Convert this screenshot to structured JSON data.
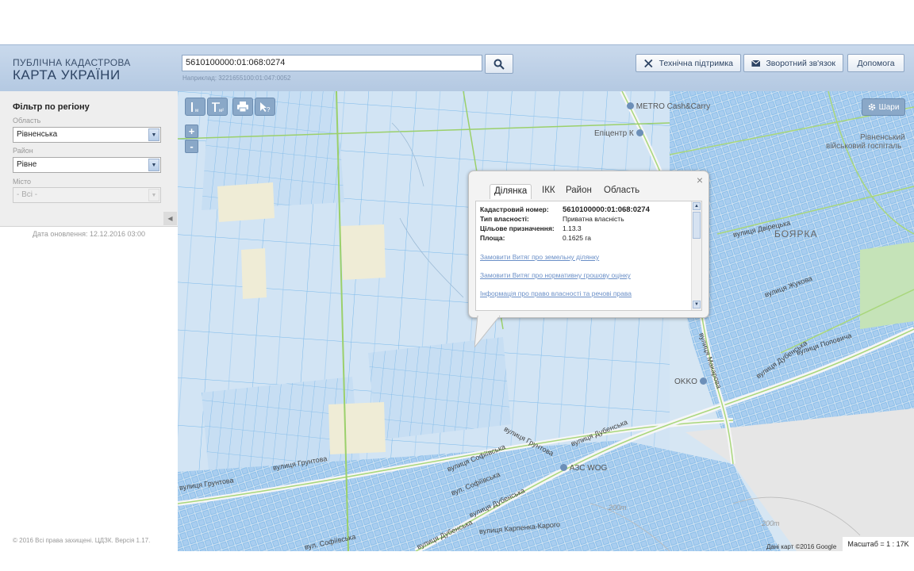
{
  "header": {
    "logo_line1": "ПУБЛІЧНА КАДАСТРОВА",
    "logo_line2": "КАРТА УКРАЇНИ",
    "search_value": "5610100000:01:068:0274",
    "search_example": "Наприклад: 3221655100:01:047:0052",
    "support_label": "Технічна підтримка",
    "feedback_label": "Зворотний зв'язок",
    "help_label": "Допомога"
  },
  "sidebar": {
    "filter_title": "Фільтр по регіону",
    "region_label": "Область",
    "region_value": "Рівненська",
    "district_label": "Район",
    "district_value": "Рівне",
    "city_label": "Місто",
    "city_value": "- Всі -",
    "updated": "Дата оновлення: 12.12.2016 03:00",
    "copyright": "© 2016 Всі права захищені. ЦДЗК. Версія 1.17."
  },
  "map": {
    "layers_label": "Шари",
    "zoom_in": "+",
    "zoom_out": "-",
    "attribution": "Дані карт ©2016 Google",
    "scale": "Масштаб = 1 : 17K",
    "pois": {
      "metro": "METRO Cash&Carry",
      "epicentr": "Епіцентр К",
      "okko": "OKKO",
      "azs": "АЗС WOG",
      "boiarka": "БОЯРКА",
      "hospital1": "Рівненський",
      "hospital2": "військовий госпіталь"
    },
    "streets": {
      "gruntova1": "вулиця Грунтова",
      "gruntova2": "вулиця Грунтова",
      "gruntova3": "вулиця Грунтова",
      "sofiivska1": "вулиця Софіївська",
      "sofiivska2": "вул. Софіївська",
      "sofiivska3": "вул. Софіївська",
      "dubenska1": "вулиця Дубенська",
      "dubenska2": "вулиця Дубенська",
      "dubenska3": "вулиця Дубенська",
      "dubenska4": "вулиця Дубенська",
      "karpenko": "вулиця Карпенка-Карого",
      "makarova": "вулиця Макарова",
      "popovycha": "вулиця Поповича",
      "zhukova": "вулиця Жукова",
      "dvoretska": "вулиця Двірецька",
      "contour1": "200m",
      "contour2": "200m"
    },
    "popup": {
      "tabs": [
        "Ділянка",
        "ІКК",
        "Район",
        "Область"
      ],
      "cadastral_label": "Кадастровий номер:",
      "cadastral_value": "5610100000:01:068:0274",
      "ownership_label": "Тип власності:",
      "ownership_value": "Приватна власність",
      "purpose_label": "Цільове призначення:",
      "purpose_value": "1.13.3",
      "area_label": "Площа:",
      "area_value": "0.1625 га",
      "link1": "Замовити Витяг про земельну ділянку",
      "link2": "Замовити Витяг про нормативну грошову оцінку",
      "link3": "Інформація про право власності та речові права"
    }
  },
  "colors": {
    "header_bg": "#bfd2e8",
    "parcel_fill": "#c3dcf3",
    "parcel_stroke": "#6fb1e6",
    "road_green": "#9bd06b",
    "link": "#6a8fc7"
  }
}
